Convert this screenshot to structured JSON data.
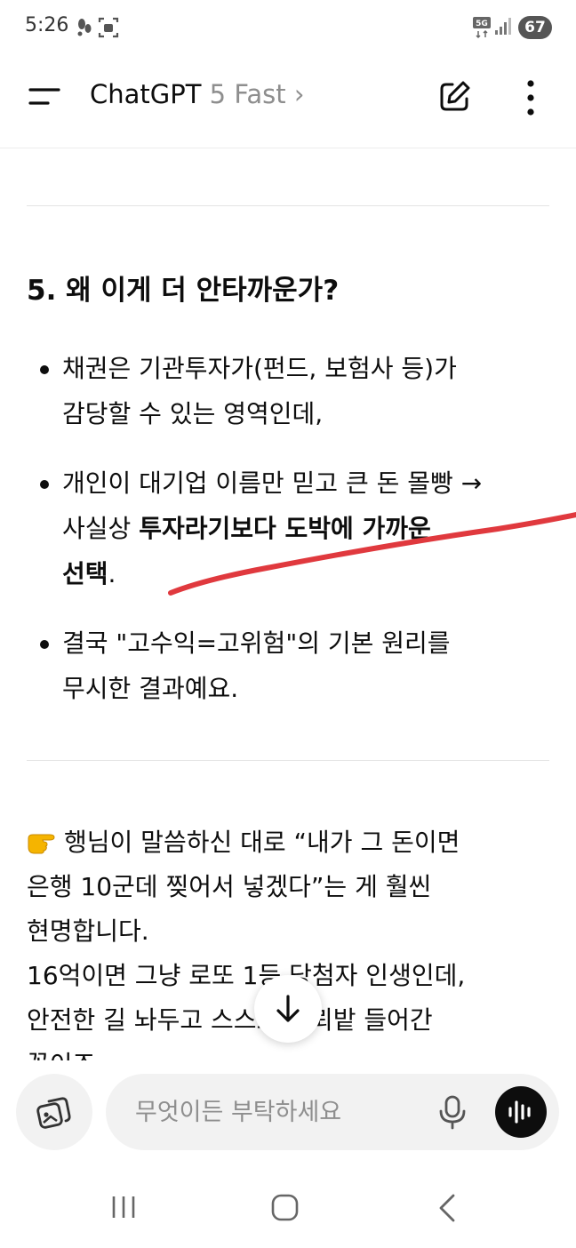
{
  "status_bar": {
    "time": "5:26",
    "network": "5G",
    "battery": "67"
  },
  "header": {
    "app_name": "ChatGPT",
    "model_label": "5 Fast",
    "chevron": "›"
  },
  "message": {
    "heading": "5. 왜 이게 더 안타까운가?",
    "bullets": [
      {
        "lines": [
          "채권은 기관투자가(펀드, 보험사 등)가",
          "감당할 수 있는 영역인데,"
        ]
      },
      {
        "line1": "개인이 대기업 이름만 믿고 큰 돈 몰빵 →",
        "line2_plain": "사실상 ",
        "line2_bold": "투자라기보다 도박에 가까운",
        "line3_bold": "선택",
        "line3_plain": "."
      },
      {
        "lines": [
          "결국 \"고수익=고위험\"의 기본 원리를",
          "무시한 결과예요."
        ]
      }
    ],
    "closing_lines": [
      "행님이 말씀하신 대로 “내가 그 돈이면",
      "은행 10군데 찢어서 넣겠다”는 게 훨씬",
      "현명합니다.",
      "16억이면 그냥 로또 1등 당첨자 인생인데,",
      "안전한 길 놔두고 스스로 지뢰밭 들어간",
      "꼴이죠."
    ],
    "highlight_color": "#e0393e"
  },
  "composer": {
    "placeholder": "무엇이든 부탁하세요"
  },
  "icons": {
    "menu": "menu-icon",
    "edit": "new-chat-icon",
    "more": "more-vertical-icon",
    "scroll_down": "arrow-down-icon",
    "attach": "image-attach-icon",
    "mic": "microphone-icon",
    "voice": "voice-mode-icon",
    "pointing": "backhand-index-pointing-right-emoji"
  }
}
